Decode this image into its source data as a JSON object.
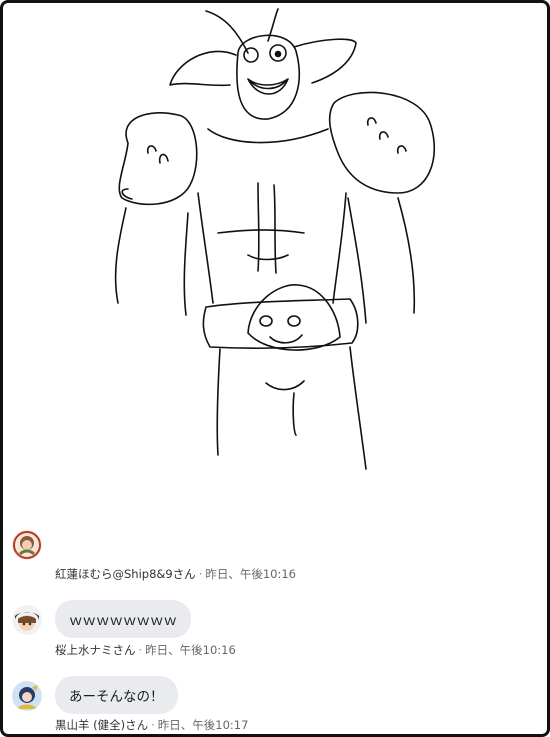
{
  "comments": [
    {
      "author": "紅蓮ほむら@Ship8&9さん",
      "separator": "·",
      "time": "昨日、午後10:16",
      "text": ""
    },
    {
      "author": "桜上水ナミさん",
      "separator": "·",
      "time": "昨日、午後10:16",
      "text": "ｗｗｗｗｗｗｗｗ"
    },
    {
      "author": "黒山羊 (健全)さん",
      "separator": "·",
      "time": "昨日、午後10:17",
      "text": "あーそんなの！"
    }
  ],
  "colors": {
    "bubble": "#e9ebee",
    "meta": "#65676b",
    "frame": "#111111"
  },
  "icons": [
    "avatar-homura",
    "avatar-nami",
    "avatar-kuroyagi"
  ]
}
